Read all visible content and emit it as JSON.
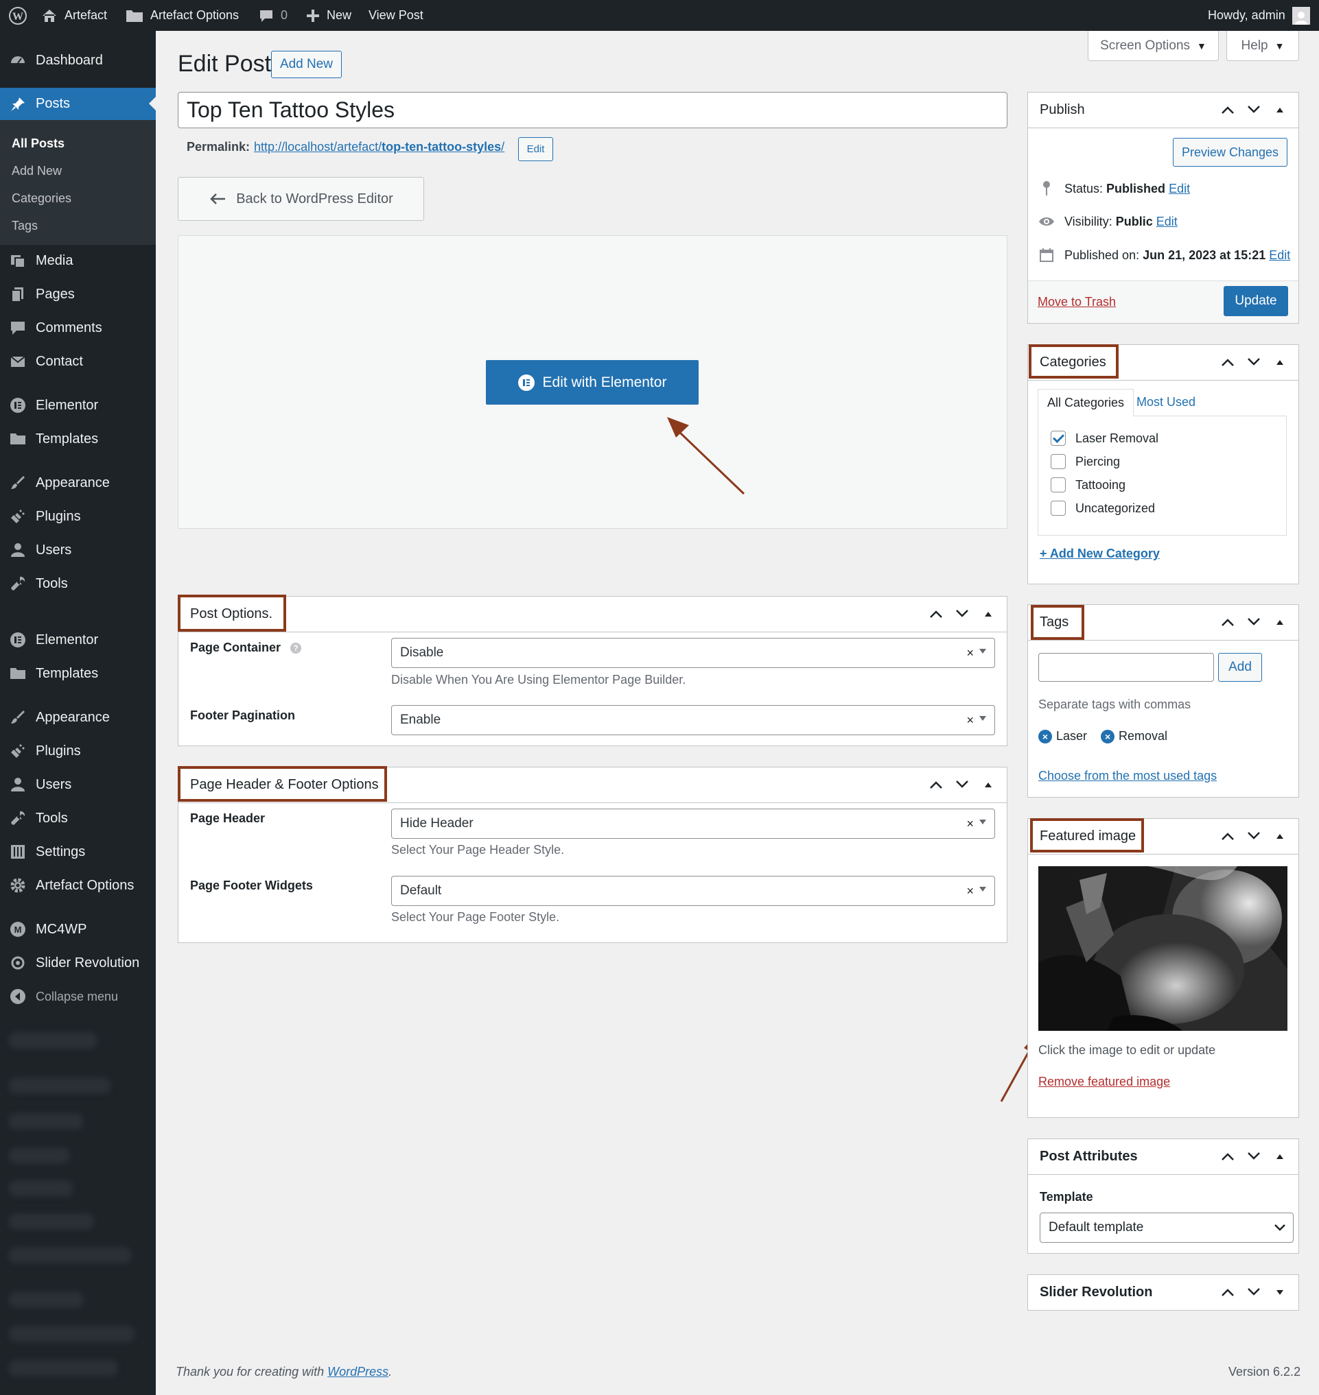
{
  "adminbar": {
    "site_name": "Artefact",
    "options_label": "Artefact Options",
    "comments_count": "0",
    "new_label": "New",
    "view_post_label": "View Post",
    "howdy": "Howdy, admin"
  },
  "sidebar": {
    "dashboard": "Dashboard",
    "posts": "Posts",
    "submenu": [
      "All Posts",
      "Add New",
      "Categories",
      "Tags"
    ],
    "items": [
      "Media",
      "Pages",
      "Comments",
      "Contact",
      "Elementor",
      "Templates",
      "Appearance",
      "Plugins",
      "Users",
      "Tools",
      "Elementor",
      "Templates",
      "Appearance",
      "Plugins",
      "Users",
      "Tools",
      "Settings",
      "Artefact Options",
      "MC4WP",
      "Slider Revolution"
    ],
    "collapse": "Collapse menu"
  },
  "header": {
    "title": "Edit Post",
    "add_new": "Add New",
    "screen_options": "Screen Options",
    "help": "Help"
  },
  "post": {
    "title_value": "Top Ten Tattoo Styles",
    "permalink_label": "Permalink:",
    "permalink_base": "http://localhost/artefact/",
    "permalink_slug": "top-ten-tattoo-styles",
    "permalink_end": "/",
    "permalink_edit": "Edit",
    "back_to_editor": "Back to WordPress Editor",
    "edit_with_elementor": "Edit with Elementor"
  },
  "post_options": {
    "title": "Post Options.",
    "page_container_label": "Page Container",
    "page_container_value": "Disable",
    "page_container_desc": "Disable When You Are Using Elementor Page Builder.",
    "footer_pagination_label": "Footer Pagination",
    "footer_pagination_value": "Enable"
  },
  "header_footer": {
    "title": "Page Header & Footer Options",
    "page_header_label": "Page Header",
    "page_header_value": "Hide Header",
    "page_header_desc": "Select Your Page Header Style.",
    "footer_widgets_label": "Page Footer Widgets",
    "footer_widgets_value": "Default",
    "footer_widgets_desc": "Select Your Page Footer Style."
  },
  "publish": {
    "title": "Publish",
    "preview": "Preview Changes",
    "status_label": "Status:",
    "status_value": "Published",
    "visibility_label": "Visibility:",
    "visibility_value": "Public",
    "published_label": "Published on:",
    "published_value": "Jun 21, 2023 at 15:21",
    "edit": "Edit",
    "trash": "Move to Trash",
    "update": "Update"
  },
  "categories": {
    "title": "Categories",
    "tab_all": "All Categories",
    "tab_used": "Most Used",
    "items": [
      {
        "label": "Laser Removal",
        "checked": true
      },
      {
        "label": "Piercing",
        "checked": false
      },
      {
        "label": "Tattooing",
        "checked": false
      },
      {
        "label": "Uncategorized",
        "checked": false
      }
    ],
    "add_new": "+ Add New Category"
  },
  "tags": {
    "title": "Tags",
    "input_value": "",
    "add": "Add",
    "hint": "Separate tags with commas",
    "chips": [
      "Laser",
      "Removal"
    ],
    "choose": "Choose from the most used tags"
  },
  "featured": {
    "title": "Featured image",
    "hint": "Click the image to edit or update",
    "remove": "Remove featured image"
  },
  "attributes": {
    "title": "Post Attributes",
    "template_label": "Template",
    "template_value": "Default template"
  },
  "slider": {
    "title": "Slider Revolution"
  },
  "footer": {
    "thanks_prefix": "Thank you for creating with ",
    "thanks_link": "WordPress",
    "thanks_suffix": ".",
    "version": "Version 6.2.2"
  },
  "colors": {
    "accent": "#2271b1",
    "highlight": "#8b3a1c",
    "sidebar": "#1d2327",
    "danger": "#b32d2e"
  }
}
